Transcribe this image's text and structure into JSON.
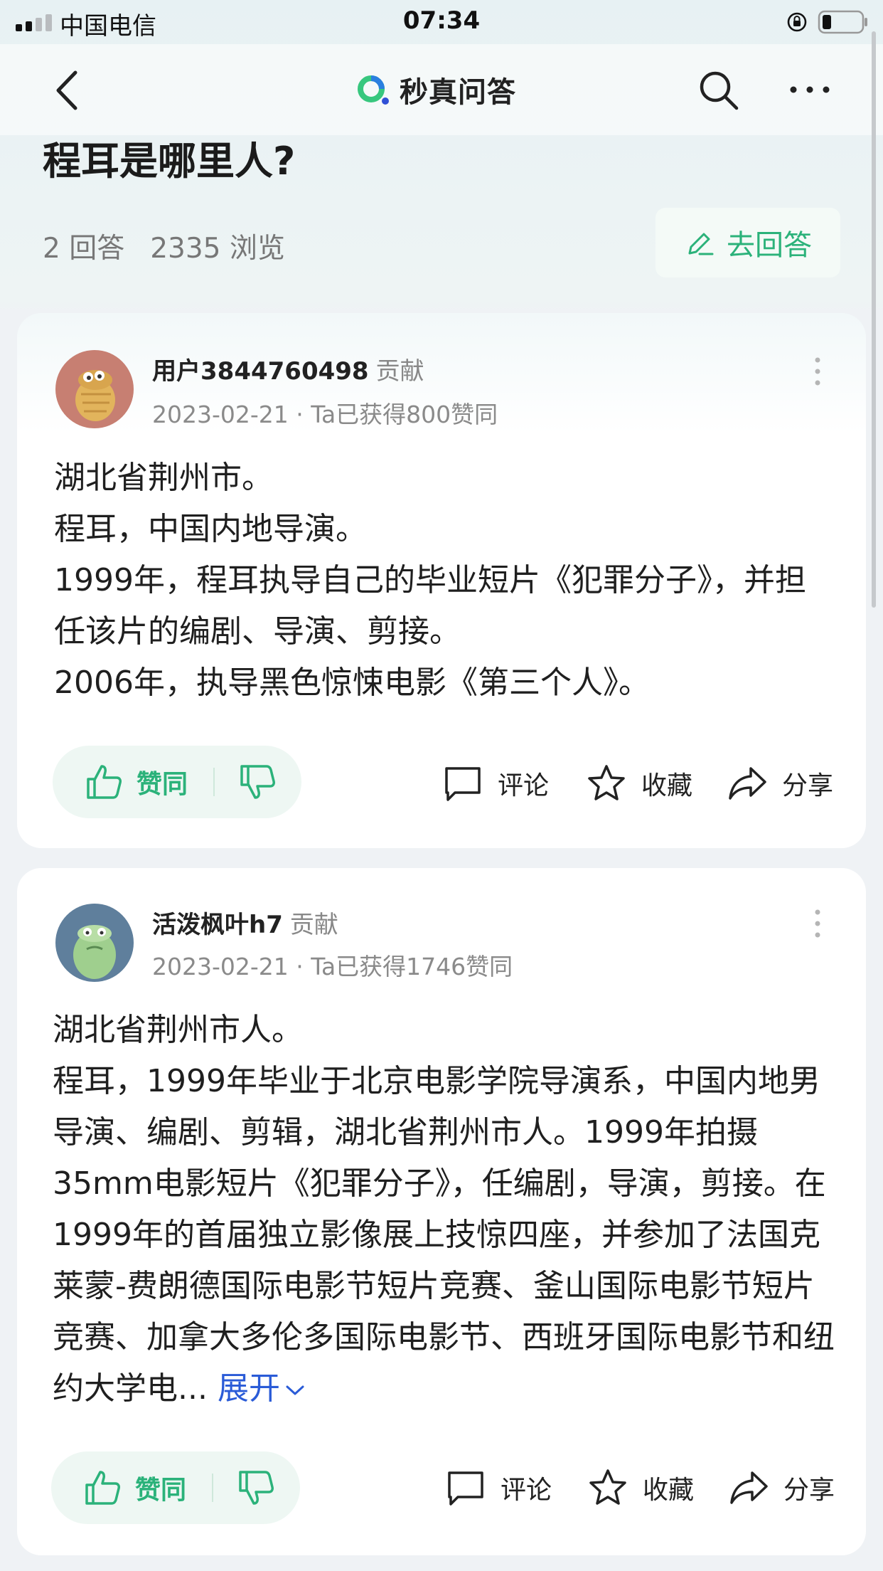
{
  "status_bar": {
    "carrier": "中国电信",
    "time": "07:34"
  },
  "nav": {
    "brand_name": "秒真问答",
    "icons": [
      "back-icon",
      "brand-logo",
      "search-icon",
      "more-icon"
    ]
  },
  "question": {
    "title": "程耳是哪里人?",
    "answers_count": "2 回答",
    "views": "2335 浏览",
    "answer_button_label": "去回答"
  },
  "answers": [
    {
      "author": "用户3844760498",
      "badge": "贡献",
      "meta": "2023-02-21 · Ta已获得800赞同",
      "paragraphs": [
        "湖北省荆州市。",
        "程耳，中国内地导演。",
        "1999年，程耳执导自己的毕业短片《犯罪分子》，并担任该片的编剧、导演、剪接。",
        "2006年，执导黑色惊悚电影《第三个人》。"
      ],
      "vote_up_label": "赞同",
      "comment_label": "评论",
      "favorite_label": "收藏",
      "share_label": "分享"
    },
    {
      "author": "活泼枫叶h7",
      "badge": "贡献",
      "meta": "2023-02-21 · Ta已获得1746赞同",
      "paragraphs": [
        "湖北省荆州市人。",
        "程耳，1999年毕业于北京电影学院导演系，中国内地男导演、编剧、剪辑，湖北省荆州市人。1999年拍摄35mm电影短片《犯罪分子》，任编剧，导演，剪接。在1999年的首届独立影像展上技惊四座，并参加了法国克莱蒙-费朗德国际电影节短片竞赛、釜山国际电影节短片竞赛、加拿大多伦多国际电影节、西班牙国际电影节和纽约大学电..."
      ],
      "expand_label": "展开",
      "vote_up_label": "赞同",
      "comment_label": "评论",
      "favorite_label": "收藏",
      "share_label": "分享"
    }
  ],
  "colors": {
    "accent_green": "#2bb27a",
    "link_blue": "#2a5bd7"
  }
}
